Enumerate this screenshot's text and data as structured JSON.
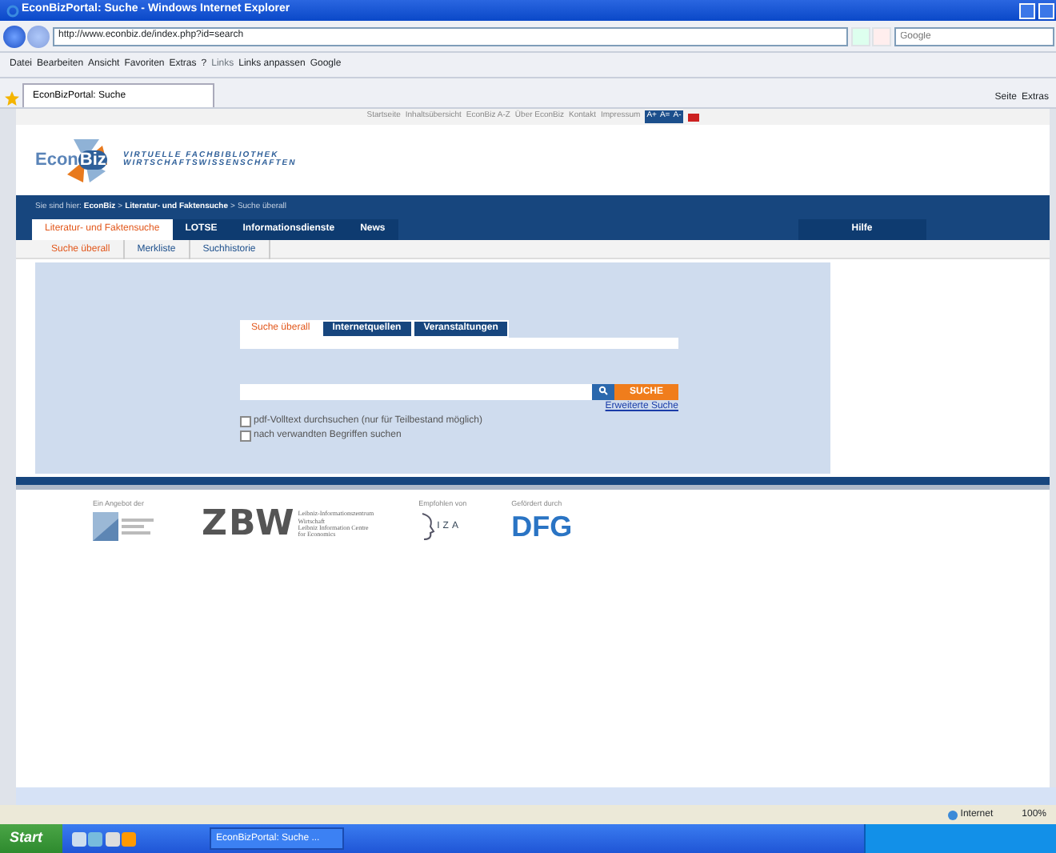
{
  "window": {
    "title": "EconBizPortal: Suche - Windows Internet Explorer"
  },
  "address_bar": {
    "url": "http://www.econbiz.de/index.php?id=search",
    "search_placeholder": "Google"
  },
  "menu": [
    "Datei",
    "Bearbeiten",
    "Ansicht",
    "Favoriten",
    "Extras",
    "?"
  ],
  "links_bar": {
    "label": "Links",
    "items": [
      "Links anpassen",
      "Google"
    ]
  },
  "browser_tabs": [
    {
      "label": "EconBizPortal: Suche",
      "selected": true
    }
  ],
  "command_bar": [
    "Seite",
    "Extras"
  ],
  "page": {
    "top_nav": [
      "Startseite",
      "Inhaltsübersicht",
      "EconBiz A-Z",
      "Über EconBiz",
      "Kontakt",
      "Impressum"
    ],
    "font_size_buttons": [
      "A+",
      "A=",
      "A-"
    ],
    "logo": {
      "part_1": "Econ",
      "part_2": "Biz",
      "tagline_1": "VIRTUELLE FACHBIBLIOTHEK",
      "tagline_2": "WIRTSCHAFTSWISSENSCHAFTEN"
    },
    "breadcrumb": {
      "prefix": "Sie sind hier:",
      "separator": ">",
      "items": [
        {
          "label": "EconBiz",
          "current": false
        },
        {
          "label": "Literatur- und Faktensuche",
          "current": false
        },
        {
          "label": "Suche überall",
          "current": true
        }
      ]
    },
    "main_tabs": [
      {
        "label": "Literatur- und Faktensuche",
        "selected": true
      },
      {
        "label": "LOTSE",
        "selected": false
      },
      {
        "label": "Informationsdienste",
        "selected": false
      },
      {
        "label": "News",
        "selected": false
      }
    ],
    "help_tab": "Hilfe",
    "sub_tabs": [
      {
        "label": "Suche überall",
        "selected": true
      },
      {
        "label": "Merkliste",
        "selected": false
      },
      {
        "label": "Suchhistorie",
        "selected": false
      }
    ],
    "search_tabs": [
      {
        "label": "Suche überall",
        "selected": true
      },
      {
        "label": "Internetquellen",
        "selected": false
      },
      {
        "label": "Veranstaltungen",
        "selected": false
      }
    ],
    "search_button": "SUCHE",
    "advanced_link": "Erweiterte Suche",
    "options": [
      {
        "label": "pdf-Volltext durchsuchen (nur für Teilbestand möglich)",
        "checked": false
      },
      {
        "label": "nach verwandten Begriffen suchen",
        "checked": false
      }
    ],
    "footer": [
      {
        "caption": "Ein Angebot der",
        "kind": "usb"
      },
      {
        "kind": "zbw",
        "logo": "ZBW",
        "lines": [
          "Leibniz-Informationszentrum",
          "Wirtschaft",
          "Leibniz Information Centre",
          "for Economics"
        ]
      },
      {
        "caption": "Empfohlen von",
        "kind": "iza",
        "logo": "IZA"
      },
      {
        "caption": "Gefördert durch",
        "kind": "dfg",
        "logo": "DFG"
      }
    ]
  },
  "status_bar": {
    "zone": "Internet",
    "zoom": "100%"
  },
  "taskbar": {
    "start": "Start",
    "tasks": [
      "EconBizPortal: Suche ..."
    ]
  }
}
